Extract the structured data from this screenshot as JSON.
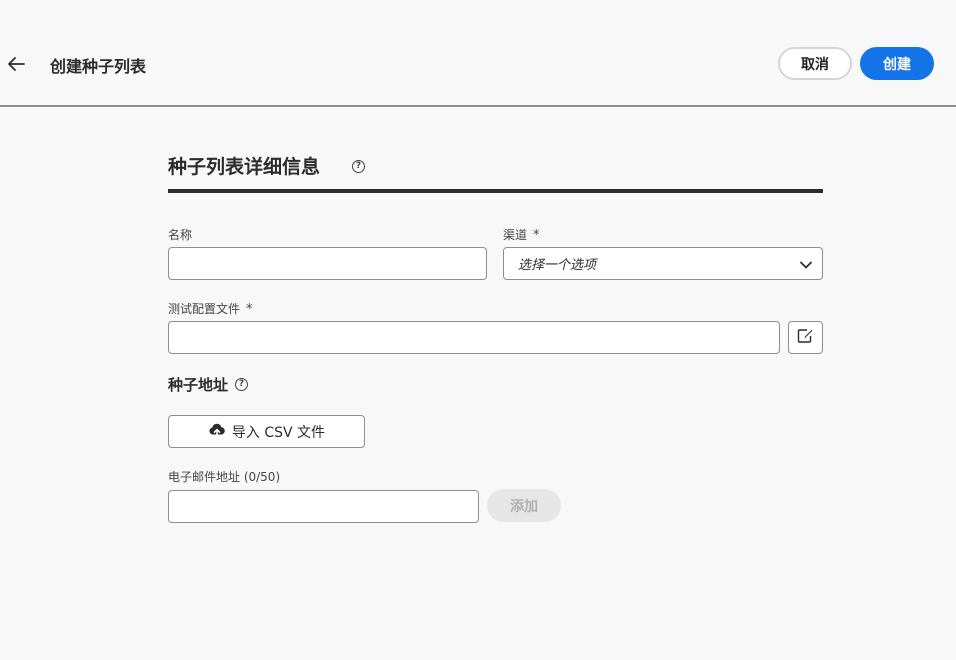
{
  "header": {
    "title": "创建种子列表",
    "cancel_label": "取消",
    "create_label": "创建"
  },
  "section": {
    "title": "种子列表详细信息",
    "help": "?"
  },
  "form": {
    "name_label": "名称",
    "name_value": "",
    "channel_label": "渠道",
    "channel_required": "*",
    "channel_placeholder": "选择一个选项",
    "profile_label": "测试配置文件",
    "profile_required": "*",
    "profile_value": ""
  },
  "seeds": {
    "title": "种子地址",
    "help": "?",
    "import_label": "导入 CSV 文件",
    "email_label": "电子邮件地址 (0/50)",
    "email_value": "",
    "add_label": "添加"
  },
  "colors": {
    "primary": "#1473e6",
    "disabled": "#e6e6e6",
    "rule": "#2c2c2c"
  }
}
